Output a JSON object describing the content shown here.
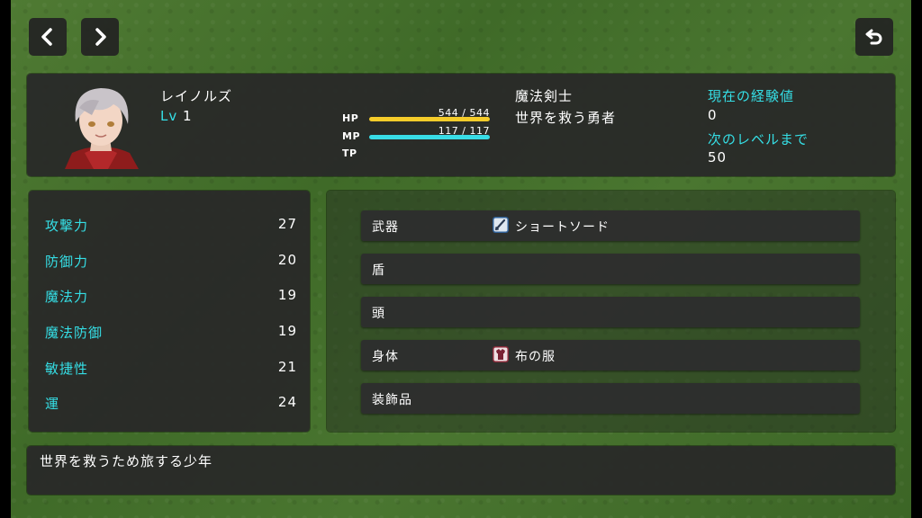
{
  "nav": {
    "prev_icon": "chevron-left-icon",
    "next_icon": "chevron-right-icon",
    "back_icon": "return-arrow-icon"
  },
  "actor": {
    "name": "レイノルズ",
    "level_label": "Lv",
    "level": "1",
    "class": "魔法剣士",
    "nickname": "世界を救う勇者",
    "hp": {
      "label": "HP",
      "text": "544 / 544",
      "current": 544,
      "max": 544,
      "color": "#f5cc2a"
    },
    "mp": {
      "label": "MP",
      "text": "117 / 117",
      "current": 117,
      "max": 117,
      "color": "#38dce6"
    },
    "tp": {
      "label": "TP"
    },
    "exp": {
      "current_label": "現在の経験値",
      "current": "0",
      "next_label": "次のレベルまで",
      "next": "50"
    }
  },
  "params": [
    {
      "name": "攻撃力",
      "value": "27"
    },
    {
      "name": "防御力",
      "value": "20"
    },
    {
      "name": "魔法力",
      "value": "19"
    },
    {
      "name": "魔法防御",
      "value": "19"
    },
    {
      "name": "敏捷性",
      "value": "21"
    },
    {
      "name": "運",
      "value": "24"
    }
  ],
  "equips": [
    {
      "slot": "武器",
      "item": "ショートソード",
      "icon": "sword-icon"
    },
    {
      "slot": "盾",
      "item": "",
      "icon": ""
    },
    {
      "slot": "頭",
      "item": "",
      "icon": ""
    },
    {
      "slot": "身体",
      "item": "布の服",
      "icon": "cloth-armor-icon"
    },
    {
      "slot": "装飾品",
      "item": "",
      "icon": ""
    }
  ],
  "profile": "世界を救うため旅する少年",
  "colors": {
    "accent": "#35dfe6",
    "window": "#282828"
  }
}
